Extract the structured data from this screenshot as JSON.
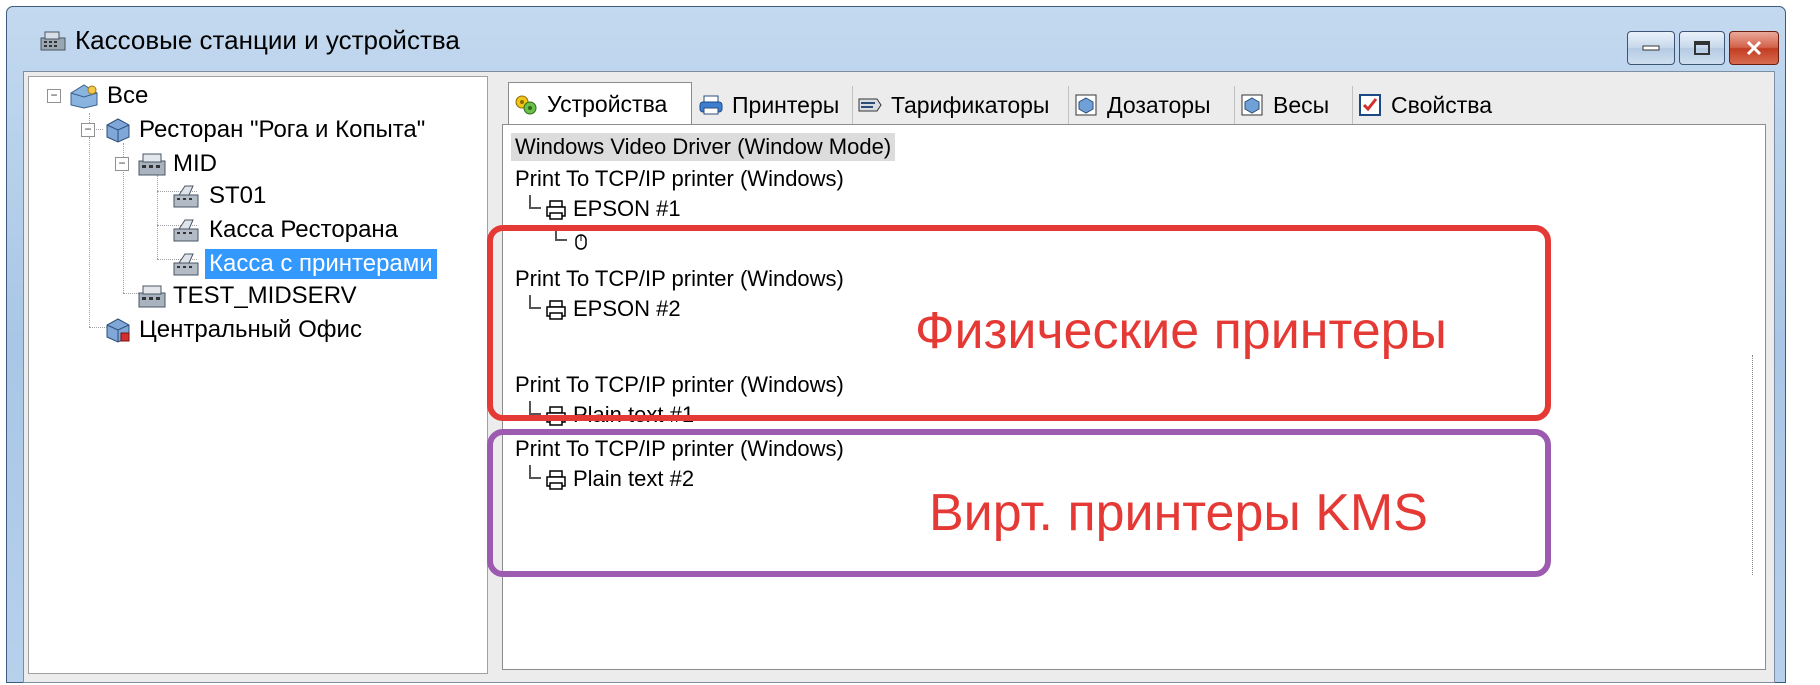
{
  "window": {
    "title": "Кассовые станции и устройства",
    "buttons": [
      "minimize",
      "maximize",
      "close"
    ]
  },
  "tree": {
    "root": "Все",
    "restaurant": "Ресторан \"Рога и Копыта\"",
    "mid": "MID",
    "st01": "ST01",
    "kassa_restorana": "Касса Ресторана",
    "kassa_printers": "Касса с принтерами",
    "test_midserv": "TEST_MIDSERV",
    "central_office": "Центральный Офис"
  },
  "tabs": [
    {
      "label": "Устройства",
      "active": true,
      "icon": "devices-icon"
    },
    {
      "label": "Принтеры",
      "active": false,
      "icon": "printer-icon"
    },
    {
      "label": "Тарификаторы",
      "active": false,
      "icon": "tariff-icon"
    },
    {
      "label": "Дозаторы",
      "active": false,
      "icon": "dispenser-icon"
    },
    {
      "label": "Весы",
      "active": false,
      "icon": "scales-icon"
    },
    {
      "label": "Свойства",
      "active": false,
      "icon": "properties-icon"
    }
  ],
  "devices": {
    "video_driver": "Windows Video Driver (Window Mode)",
    "tcp1": "Print To TCP/IP printer (Windows)",
    "epson1": "EPSON #1",
    "tcp2": "Print To TCP/IP printer (Windows)",
    "epson2": "EPSON #2",
    "tcp3": "Print To TCP/IP printer (Windows)",
    "plain1": "Plain text #1",
    "tcp4": "Print To TCP/IP printer (Windows)",
    "plain2": "Plain text #2"
  },
  "annotations": {
    "physical": "Физические принтеры",
    "virtual": "Вирт. принтеры KMS",
    "physical_color": "#e53935",
    "virtual_color": "#9c5bb0"
  },
  "colors": {
    "selection": "#3399ff",
    "title_gradient": "#b7d0ec"
  }
}
